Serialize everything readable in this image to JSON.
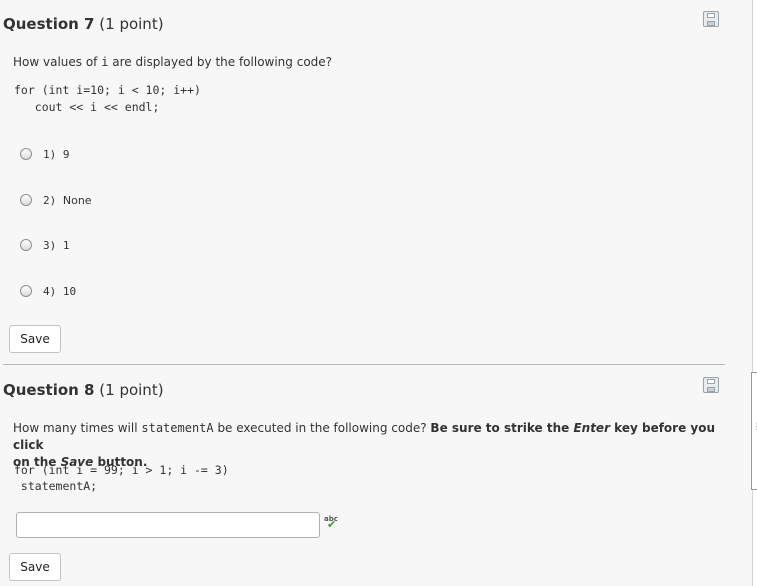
{
  "q7": {
    "title": "Question 7",
    "points": "(1 point)",
    "prompt_pre": "How values of ",
    "prompt_var": "i",
    "prompt_post": " are displayed by the following code?",
    "code_line1": "for (int i=10; i < 10; i++)",
    "code_line2": "   cout << i << endl;",
    "options": [
      {
        "num": "1)",
        "text": "9"
      },
      {
        "num": "2)",
        "text": "None"
      },
      {
        "num": "3)",
        "text": "1"
      },
      {
        "num": "4)",
        "text": "10"
      }
    ],
    "save_label": "Save"
  },
  "q8": {
    "title": "Question 8",
    "points": "(1 point)",
    "prompt_pre": "How many times will ",
    "prompt_var": "statementA",
    "prompt_mid": " be executed in the following code? ",
    "prompt_bold1": "Be sure to strike the ",
    "prompt_bold_italic1": "Enter",
    "prompt_bold2": " key before you click",
    "prompt_bold3": "on the ",
    "prompt_bold_italic2": "Save",
    "prompt_bold4": " button.",
    "code_line1": "for (int i = 99; i > 1; i -= 3)",
    "code_line2": " statementA;",
    "answer_value": "",
    "spell_label": "abc",
    "save_label": "Save"
  }
}
